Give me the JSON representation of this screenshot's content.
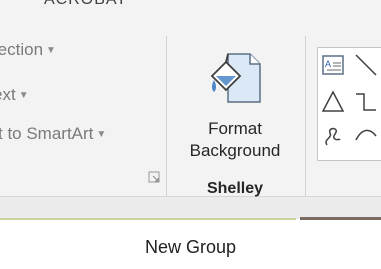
{
  "ribbon": {
    "top_tab_label": "ACROBAT",
    "text_group": {
      "commands": [
        {
          "label": "Text Direction",
          "visible_text": "rection",
          "has_dropdown": true
        },
        {
          "label": "Align Text",
          "visible_text": "ext",
          "has_dropdown": true
        },
        {
          "label": "Convert to SmartArt",
          "visible_text": "t to SmartArt",
          "has_dropdown": true
        }
      ],
      "launcher_icon": "dialog-launcher-icon"
    },
    "shelley_group": {
      "button_label": "Format Background",
      "button_label_line1": "Format",
      "button_label_line2": "Background",
      "button_icon": "paint-bucket-page-icon",
      "group_label": "Shelley"
    },
    "shapes_gallery": {
      "items": [
        "text-box-shape-icon",
        "line-shape-icon",
        "triangle-shape-icon",
        "elbow-connector-shape-icon",
        "freeform-scribble-shape-icon",
        "curve-shape-icon"
      ]
    }
  },
  "new_group_label": "New Group",
  "colors": {
    "ribbon_bg": "#f3f3f3",
    "text_dim": "#7a7a7a",
    "text_dark": "#262626",
    "accent_blue": "#4a86c8",
    "green_line": "#c7d39a"
  }
}
